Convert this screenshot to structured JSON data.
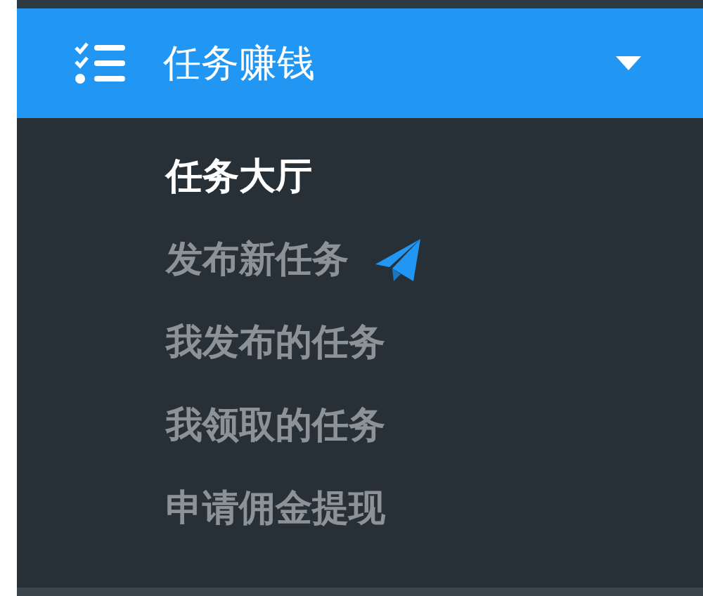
{
  "menu": {
    "title": "任务赚钱",
    "expanded": true,
    "items": [
      {
        "label": "任务大厅",
        "selected": true,
        "kind": "plain"
      },
      {
        "label": "发布新任务",
        "selected": false,
        "kind": "with-icon"
      },
      {
        "label": "我发布的任务",
        "selected": false,
        "kind": "plain"
      },
      {
        "label": "我领取的任务",
        "selected": false,
        "kind": "plain"
      },
      {
        "label": "申请佣金提现",
        "selected": false,
        "kind": "plain"
      }
    ]
  }
}
